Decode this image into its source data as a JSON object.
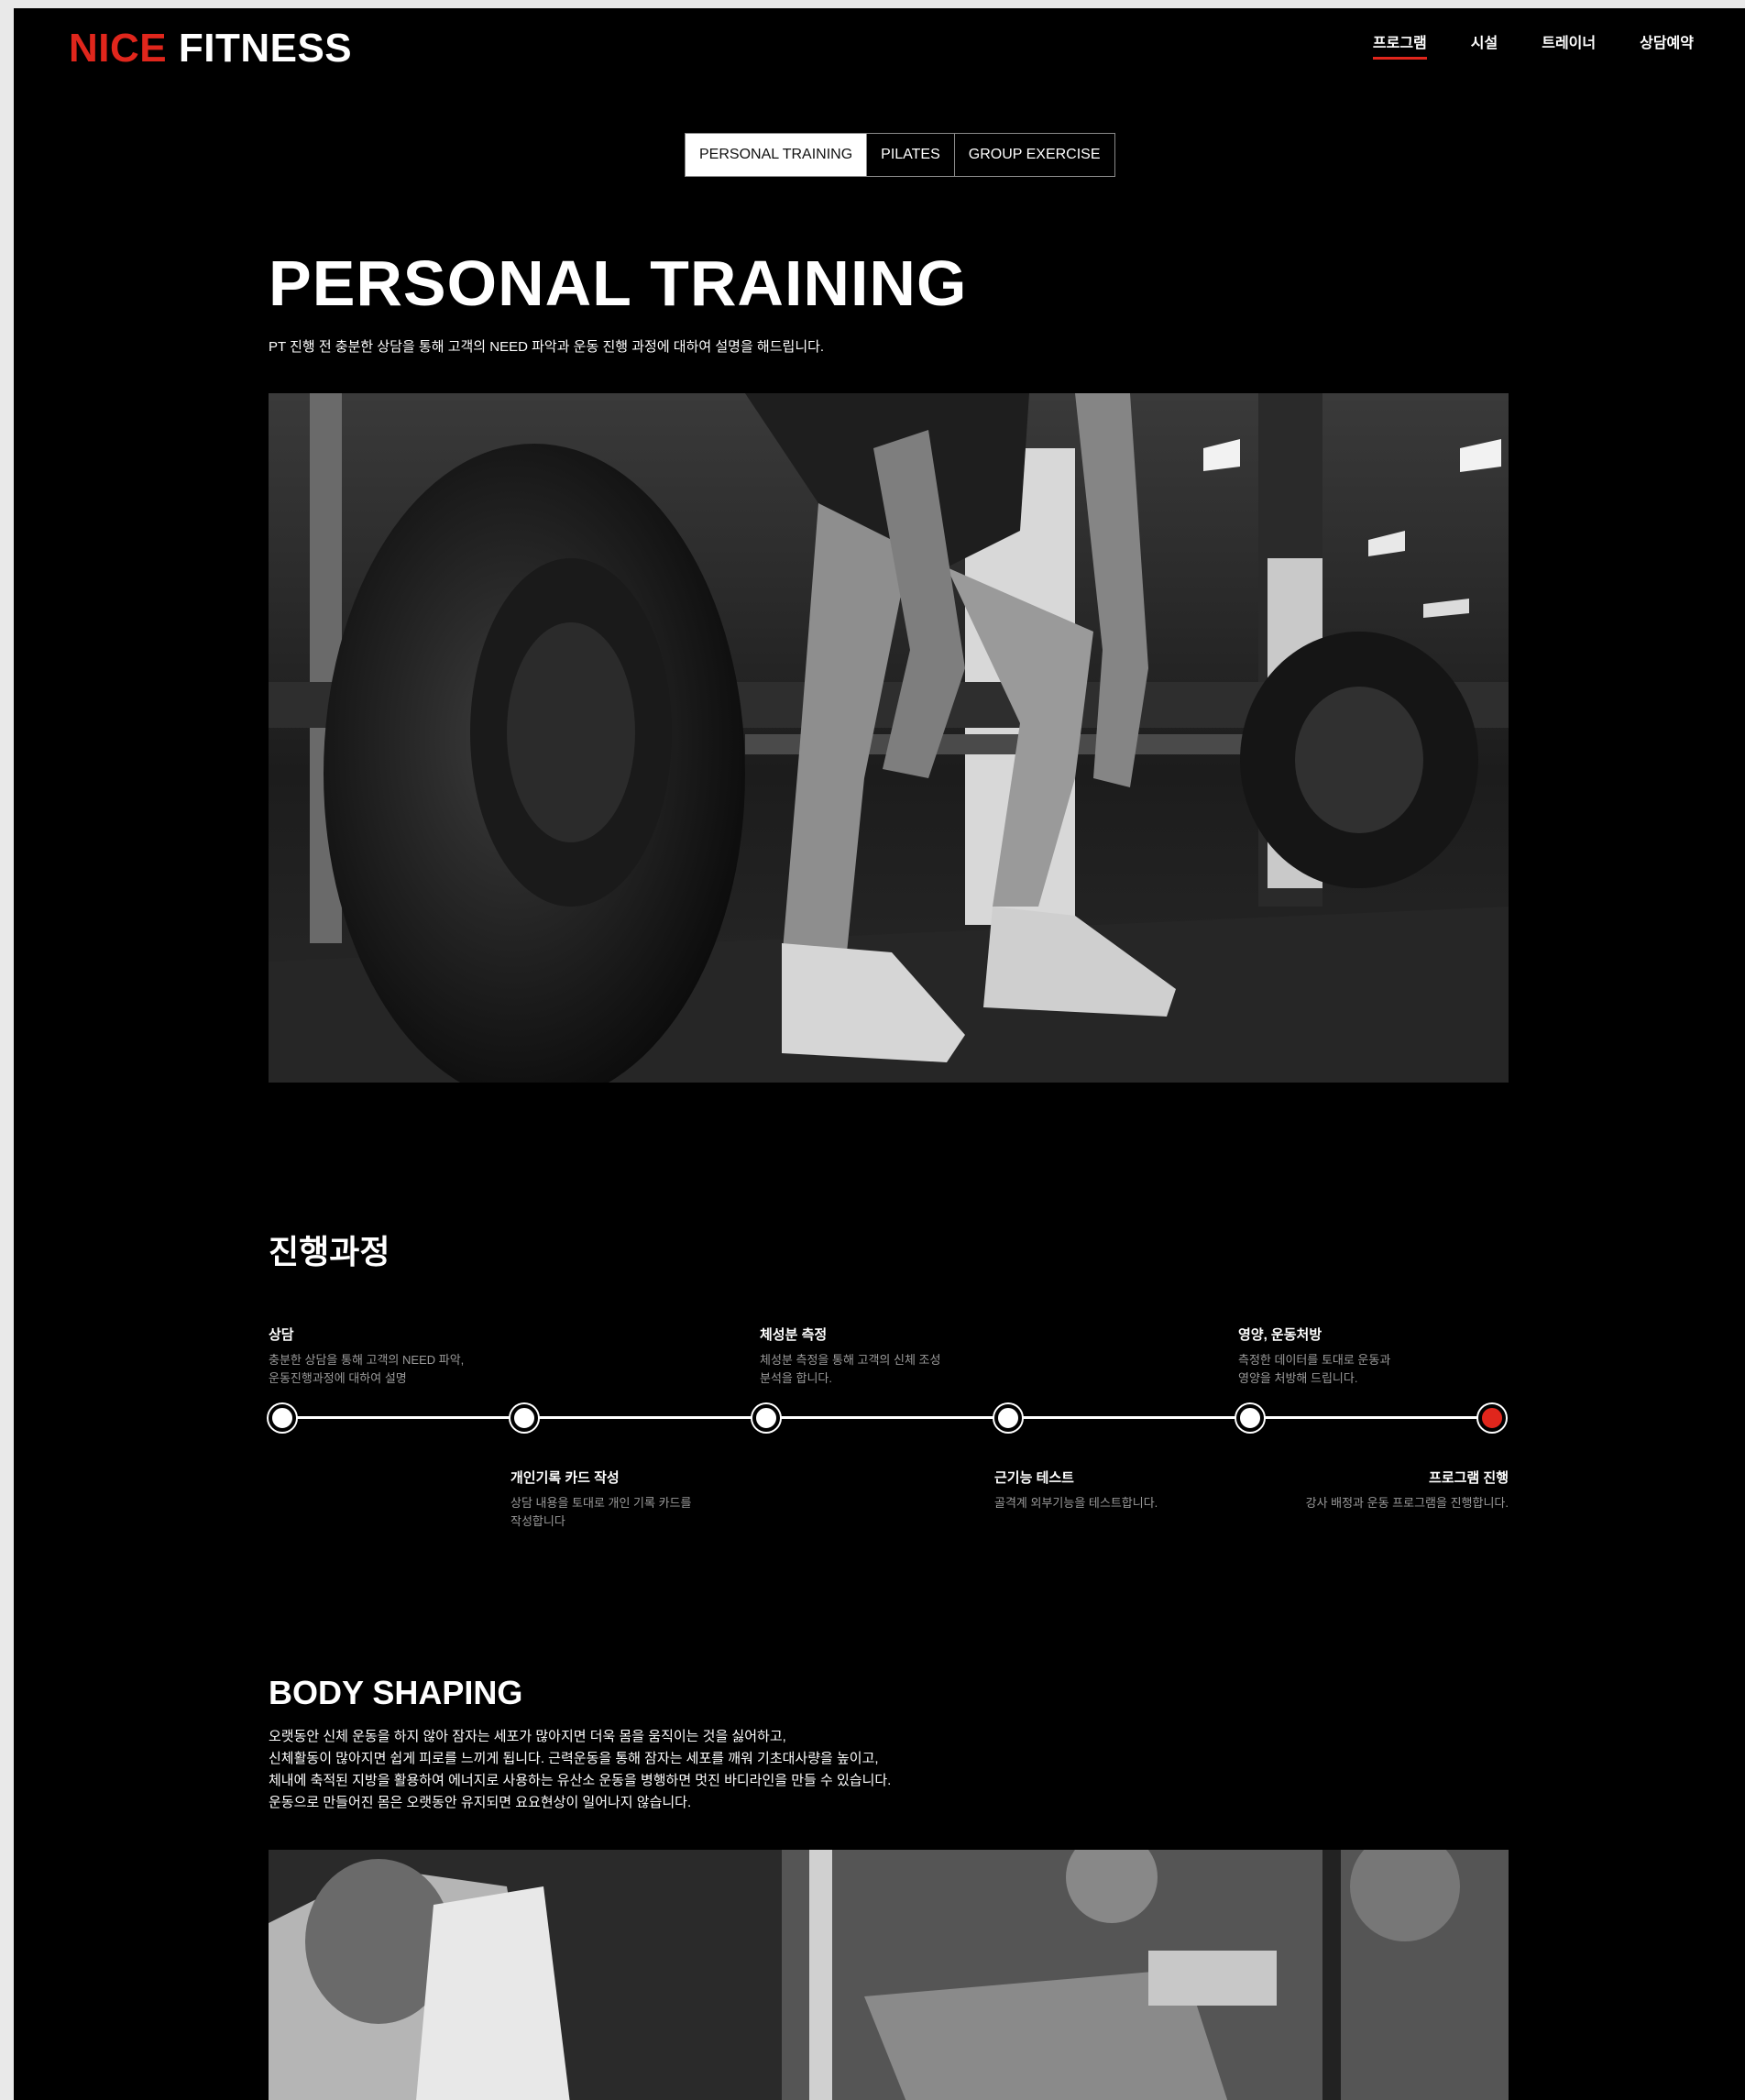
{
  "brand": {
    "accent": "NICE",
    "main": "FITNESS"
  },
  "nav": [
    "프로그램",
    "시설",
    "트레이너",
    "상담예약"
  ],
  "tabs": [
    "PERSONAL TRAINING",
    "PILATES",
    "GROUP EXERCISE"
  ],
  "hero": {
    "title": "PERSONAL TRAINING",
    "subtitle": "PT 진행 전 충분한 상담을 통해 고객의 NEED 파악과 운동 진행 과정에 대하여 설명을 해드립니다."
  },
  "process": {
    "title": "진행과정",
    "steps": [
      {
        "name": "상담",
        "desc1": "충분한 상담을 통해 고객의 NEED 파악,",
        "desc2": "운동진행과정에 대하여 설명"
      },
      {
        "name": "개인기록 카드 작성",
        "desc1": "상담 내용을 토대로 개인 기록 카드를",
        "desc2": "작성합니다"
      },
      {
        "name": "체성분 측정",
        "desc1": "체성분 측정을 통해 고객의 신체 조성",
        "desc2": "분석을 합니다."
      },
      {
        "name": "근기능 테스트",
        "desc1": "골격계 외부기능을 테스트합니다.",
        "desc2": ""
      },
      {
        "name": "영양, 운동처방",
        "desc1": "측정한 데이터를 토대로 운동과",
        "desc2": "영양을 처방해 드립니다."
      },
      {
        "name": "프로그램 진행",
        "desc1": "강사 배정과 운동 프로그램을 진행합니다.",
        "desc2": ""
      }
    ]
  },
  "body_shaping": {
    "title": "BODY SHAPING",
    "lines": [
      "오랫동안 신체 운동을 하지 않아 잠자는 세포가 많아지면 더욱 몸을 움직이는 것을 싫어하고,",
      "신체활동이 많아지면 쉽게 피로를 느끼게 됩니다. 근력운동을 통해 잠자는 세포를 깨워 기초대사량을 높이고,",
      "체내에 축적된 지방을 활용하여 에너지로 사용하는 유산소 운동을 병행하면 멋진 바디라인을 만들 수 있습니다.",
      "운동으로 만들어진 몸은 오랫동안 유지되면 요요현상이 일어나지 않습니다."
    ]
  },
  "colors": {
    "accent": "#e0261c",
    "background": "#000000",
    "text": "#ffffff",
    "muted": "#9a9a9a"
  }
}
